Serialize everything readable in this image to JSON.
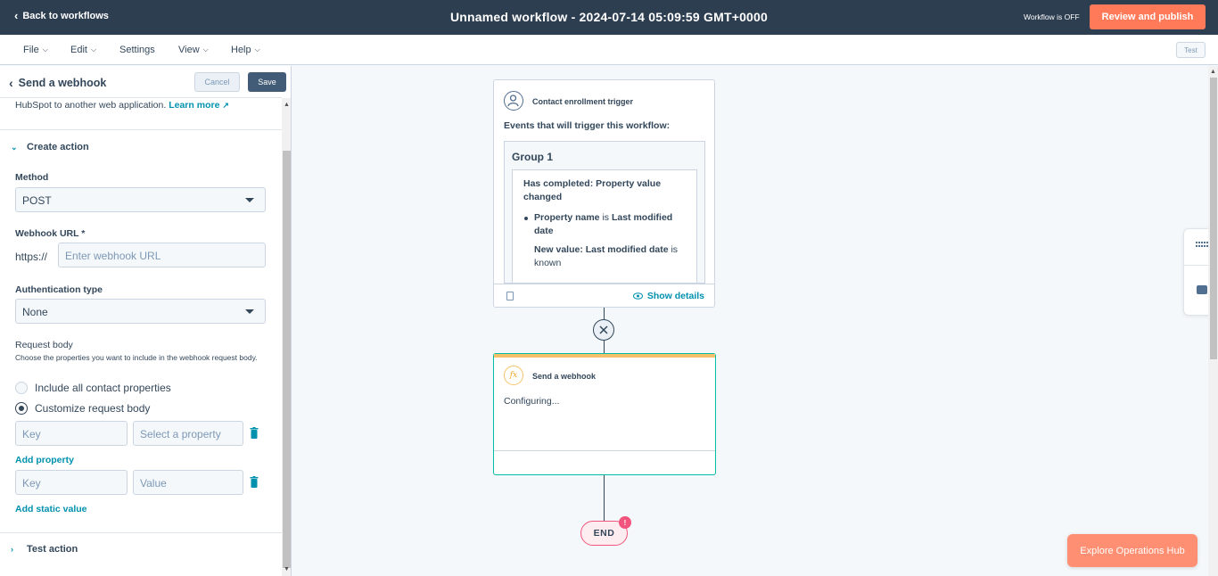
{
  "topbar": {
    "back_label": "Back to workflows",
    "title": "Unnamed workflow - 2024-07-14 05:09:59 GMT+0000",
    "status": "Workflow is OFF",
    "review_label": "Review and publish"
  },
  "menubar": {
    "items": [
      {
        "label": "File",
        "has_caret": true
      },
      {
        "label": "Edit",
        "has_caret": true
      },
      {
        "label": "Settings",
        "has_caret": false
      },
      {
        "label": "View",
        "has_caret": true
      },
      {
        "label": "Help",
        "has_caret": true
      }
    ],
    "test_label": "Test"
  },
  "panel": {
    "title": "Send a webhook",
    "cancel_label": "Cancel",
    "save_label": "Save",
    "intro_text": "HubSpot to another web application.",
    "learn_more": "Learn more",
    "create_action_label": "Create action",
    "method_label": "Method",
    "method_value": "POST",
    "webhook_url_label": "Webhook URL *",
    "url_prefix": "https://",
    "webhook_url_placeholder": "Enter webhook URL",
    "auth_label": "Authentication type",
    "auth_value": "None",
    "request_body_label": "Request body",
    "request_body_help": "Choose the properties you want to include in the webhook request body.",
    "radio_all": "Include all contact properties",
    "radio_custom": "Customize request body",
    "radio_selected": "custom",
    "property_row": {
      "key_placeholder": "Key",
      "value_placeholder": "Select a property"
    },
    "add_property_label": "Add property",
    "static_row": {
      "key_placeholder": "Key",
      "value_placeholder": "Value"
    },
    "add_static_label": "Add static value",
    "test_action_label": "Test action"
  },
  "canvas": {
    "trigger": {
      "title": "Contact enrollment trigger",
      "events_label": "Events that will trigger this workflow:",
      "group_title": "Group 1",
      "filter_head": "Has completed: Property value changed",
      "prop_name_bold": "Property name",
      "prop_name_is": "is",
      "prop_name_value": "Last modified date",
      "new_value_bold": "New value: Last modified date",
      "new_value_rest": "is known",
      "show_details": "Show details"
    },
    "action": {
      "title": "Send a webhook",
      "status": "Configuring..."
    },
    "end_label": "END",
    "end_badge": "!"
  },
  "explore_label": "Explore Operations Hub",
  "colors": {
    "topbar": "#2d3e50",
    "accent_orange": "#ff7a59",
    "link_teal": "#0091ae",
    "selected_border": "#00bda5",
    "end_pink": "#f2547d"
  }
}
